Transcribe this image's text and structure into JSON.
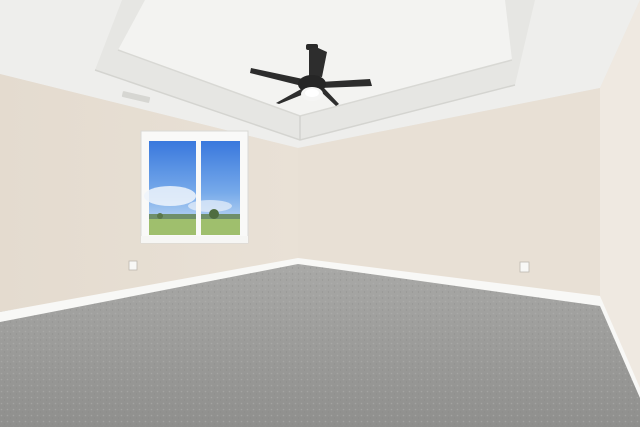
{
  "scene": {
    "description_free": true,
    "colors": {
      "ceiling": "#efefed",
      "tray_ceiling": "#f4f4f2",
      "left_wall": "#e6ddd2",
      "back_wall": "#e9e1d6",
      "right_wall": "#efe9e0",
      "carpet": "#9d9d9b",
      "baseboard": "#f7f7f5",
      "window_frame": "#fbfbfb",
      "sky_top": "#3d7fe0",
      "sky_bottom": "#b9d6f3",
      "field": "#9cbf6a",
      "fan_blade": "#2b2b2b",
      "fan_light": "#f6f6f6"
    },
    "icons": [
      "ceiling-fan-icon",
      "window-icon",
      "outlet-icon",
      "air-vent-icon"
    ]
  }
}
